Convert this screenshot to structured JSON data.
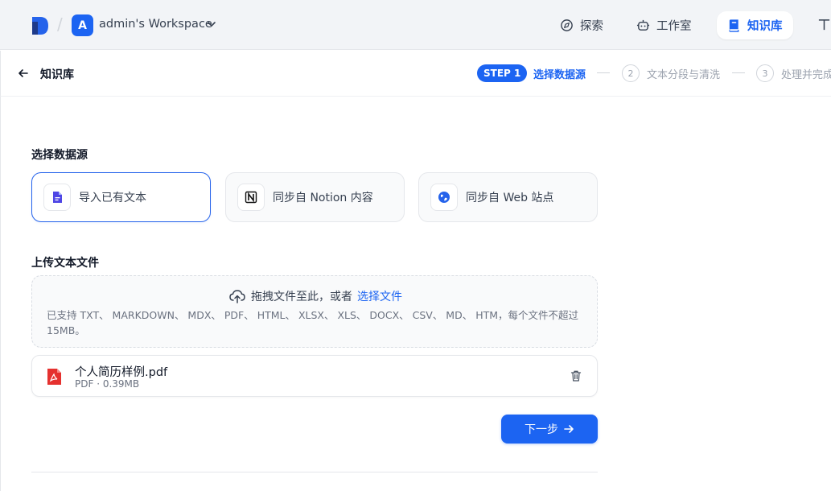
{
  "header": {
    "workspace_initial": "A",
    "workspace_name": "admin's Workspace",
    "nav": [
      {
        "label": "探索",
        "icon": "compass-icon"
      },
      {
        "label": "工作室",
        "icon": "robot-icon"
      },
      {
        "label": "知识库",
        "icon": "book-icon",
        "active": true
      }
    ]
  },
  "subheader": {
    "title": "知识库",
    "steps": [
      {
        "badge": "STEP 1",
        "label": "选择数据源",
        "active": true
      },
      {
        "number": "2",
        "label": "文本分段与清洗"
      },
      {
        "number": "3",
        "label": "处理并完成"
      }
    ]
  },
  "datasource": {
    "title": "选择数据源",
    "options": [
      {
        "label": "导入已有文本",
        "icon": "document-icon",
        "selected": true
      },
      {
        "label": "同步自 Notion 内容",
        "icon": "notion-icon"
      },
      {
        "label": "同步自 Web 站点",
        "icon": "web-icon"
      }
    ]
  },
  "upload": {
    "title": "上传文本文件",
    "drop_text": "拖拽文件至此，或者",
    "drop_link": "选择文件",
    "supported": "已支持 TXT、 MARKDOWN、 MDX、 PDF、 HTML、 XLSX、 XLS、 DOCX、 CSV、 MD、 HTM，每个文件不超过 15MB。"
  },
  "files": [
    {
      "name": "个人简历样例.pdf",
      "meta": "PDF · 0.39MB"
    }
  ],
  "actions": {
    "next_label": "下一步"
  },
  "colors": {
    "primary": "#1c64f2",
    "pdf_red": "#e5312f"
  }
}
